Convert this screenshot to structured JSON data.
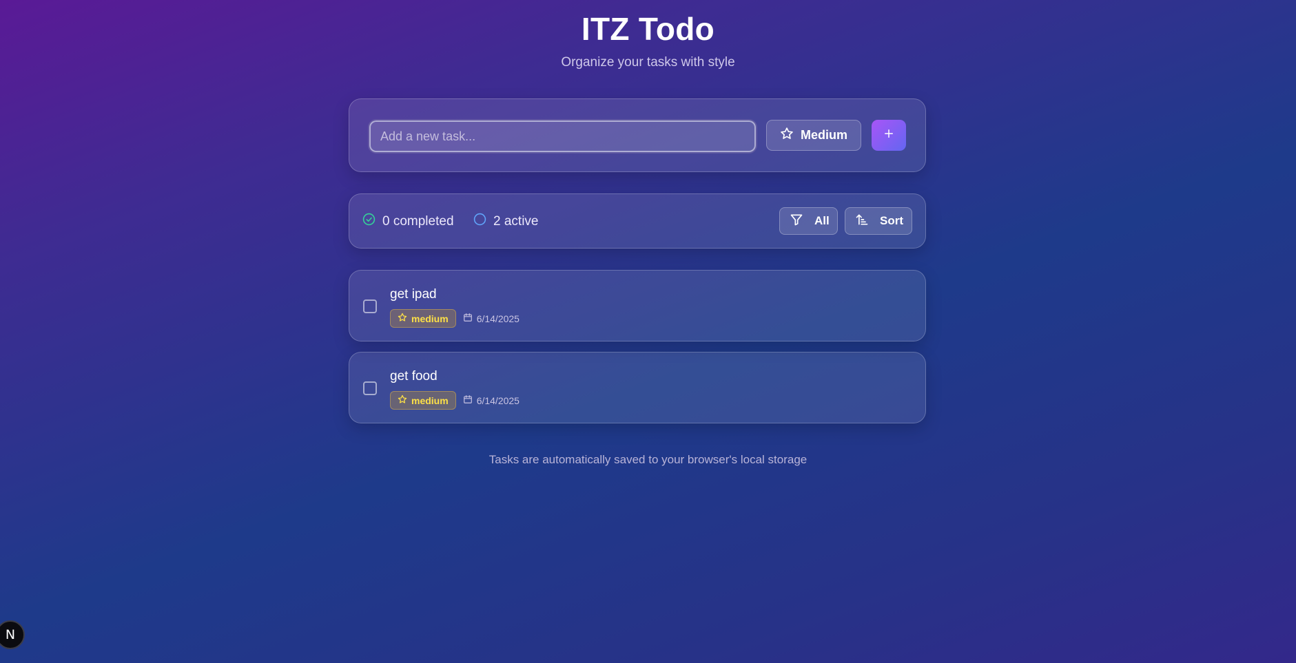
{
  "app": {
    "title": "ITZ Todo",
    "subtitle": "Organize your tasks with style"
  },
  "add_task": {
    "placeholder": "Add a new task...",
    "value": "",
    "priority_label": "Medium",
    "priority_icon": "star-icon",
    "add_icon": "plus-icon"
  },
  "stats": {
    "completed_label": "0 completed",
    "active_label": "2 active",
    "completed_icon": "check-circle-icon",
    "active_icon": "circle-icon",
    "filter_label": "All",
    "filter_icon": "filter-icon",
    "sort_label": "Sort",
    "sort_icon": "sort-icon"
  },
  "tasks": [
    {
      "title": "get ipad",
      "priority": "medium",
      "date": "6/14/2025",
      "completed": false
    },
    {
      "title": "get food",
      "priority": "medium",
      "date": "6/14/2025",
      "completed": false
    }
  ],
  "footer": {
    "note": "Tasks are automatically saved to your browser's local storage"
  },
  "dev_indicator": {
    "label": "N"
  },
  "colors": {
    "accent_start": "#a855f7",
    "accent_end": "#6366f1",
    "completed_green": "#34d399",
    "active_blue": "#60a5fa",
    "priority_yellow": "#fde047"
  }
}
